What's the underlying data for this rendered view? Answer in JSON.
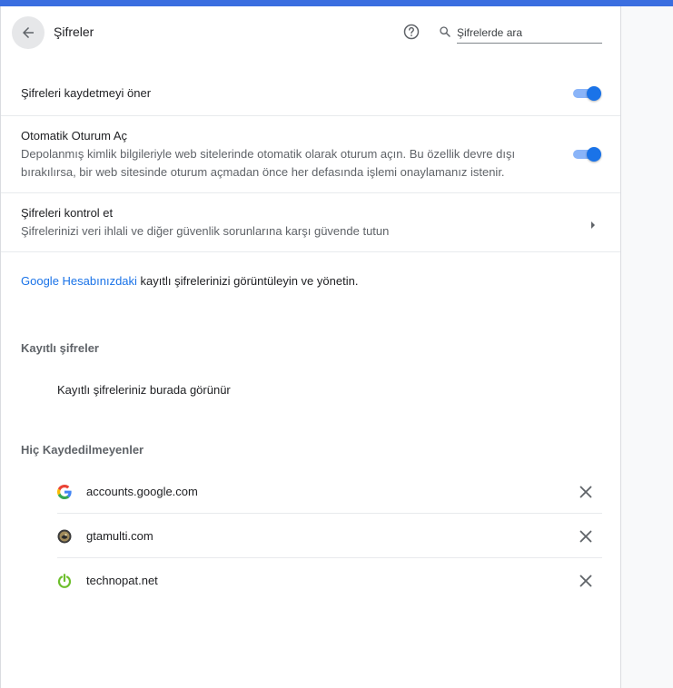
{
  "header": {
    "title": "Şifreler",
    "search_placeholder": "Şifrelerde ara"
  },
  "settings": [
    {
      "title": "Şifreleri kaydetmeyi öner",
      "subtitle": "",
      "control": "toggle",
      "enabled": true
    },
    {
      "title": "Otomatik Oturum Aç",
      "subtitle": "Depolanmış kimlik bilgileriyle web sitelerinde otomatik olarak oturum açın. Bu özellik devre dışı bırakılırsa, bir web sitesinde oturum açmadan önce her defasında işlemi onaylamanız istenir.",
      "control": "toggle",
      "enabled": true
    },
    {
      "title": "Şifreleri kontrol et",
      "subtitle": "Şifrelerinizi veri ihlali ve diğer güvenlik sorunlarına karşı güvende tutun",
      "control": "chevron"
    }
  ],
  "google_account": {
    "link_text": "Google Hesabınızdaki",
    "rest_text": " kayıtlı şifrelerinizi görüntüleyin ve yönetin."
  },
  "saved_passwords": {
    "title": "Kayıtlı şifreler",
    "empty_message": "Kayıtlı şifreleriniz burada görünür"
  },
  "never_saved": {
    "title": "Hiç Kaydedilmeyenler",
    "sites": [
      {
        "name": "accounts.google.com",
        "icon": "google-g-icon"
      },
      {
        "name": "gtamulti.com",
        "icon": "gtamulti-favicon"
      },
      {
        "name": "technopat.net",
        "icon": "power-icon"
      }
    ]
  },
  "colors": {
    "accent": "#1a73e8",
    "toggle_track": "#8ab4f8",
    "top_bar": "#3a6ee0",
    "technopat_green": "#6dbf2c"
  }
}
